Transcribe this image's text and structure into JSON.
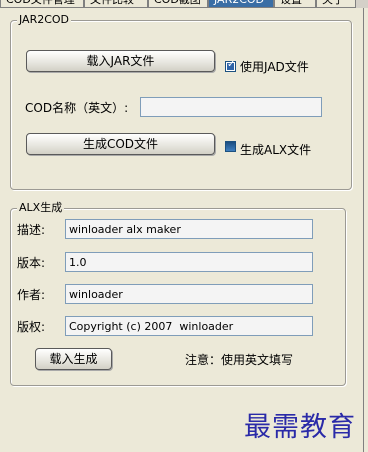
{
  "tabs": [
    {
      "label": "COD文件管理"
    },
    {
      "label": "文件比较"
    },
    {
      "label": "COD截图"
    },
    {
      "label": "JAR2COD"
    },
    {
      "label": "设置"
    },
    {
      "label": "关于"
    }
  ],
  "active_tab_index": 3,
  "jar2cod": {
    "title": "JAR2COD",
    "load_jar_button": "载入JAR文件",
    "use_jad_label": "使用JAD文件",
    "use_jad_checked": true,
    "cod_name_label": "COD名称（英文）:",
    "cod_name_value": "",
    "generate_cod_button": "生成COD文件",
    "generate_alx_label": "生成ALX文件",
    "generate_alx_checked": false
  },
  "alx": {
    "title": "ALX生成",
    "description_label": "描述:",
    "description_value": "winloader alx maker",
    "version_label": "版本:",
    "version_value": "1.0",
    "author_label": "作者:",
    "author_value": "winloader",
    "copyright_label": "版权:",
    "copyright_value": "Copyright (c) 2007  winloader",
    "load_generate_button": "载入生成",
    "note": "注意：使用英文填写"
  },
  "watermark": "最需教育",
  "colors": {
    "background": "#ece9d8",
    "active_tab": "#3a6ea5",
    "checkbox_blue": "#2f64a8",
    "watermark": "#2a2aa8"
  }
}
